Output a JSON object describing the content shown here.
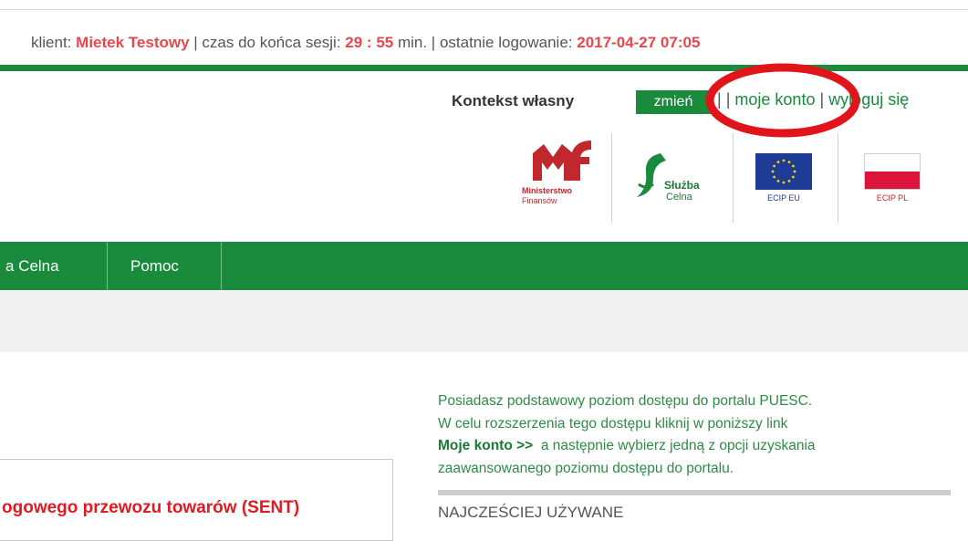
{
  "session": {
    "client_label": "klient:",
    "client_name": "Mietek Testowy",
    "session_label": "| czas do końca sesji:",
    "session_time": "29 : 55",
    "session_unit": "min. | ostatnie logowanie:",
    "last_login": "2017-04-27 07:05"
  },
  "context": {
    "label": "Kontekst własny",
    "change_button": "zmień",
    "sep1": "|",
    "sep2": "|",
    "my_account_link": "moje konto",
    "sep3": "|",
    "logout_link": "wyloguj się"
  },
  "logos": {
    "mf_line1": "Ministerstwo",
    "mf_line2": "Finansów",
    "sc_line1": "Służba",
    "sc_line2": "Celna",
    "eu_caption": "ECIP EU",
    "pl_caption": "ECIP PL"
  },
  "nav": {
    "items": [
      {
        "label": "a Celna"
      },
      {
        "label": "Pomoc"
      }
    ]
  },
  "info": {
    "line1": "Posiadasz podstawowy poziom dostępu do portalu PUESC.",
    "line2": "W celu rozszerzenia tego dostępu kliknij w poniższy link",
    "link": "Moje konto >>",
    "line3": "  a następnie wybierz jedną z opcji uzyskania",
    "line4": "zaawansowanego poziomu dostępu do portalu."
  },
  "most_used": {
    "title": "NAJCZEŚCIEJ UŻYWANE"
  },
  "card": {
    "title": "ogowego przewozu towarów (SENT)"
  },
  "colors": {
    "brand_green": "#1a8a3c",
    "highlight_red": "#e8484d",
    "annotation_red": "#e0141a"
  }
}
